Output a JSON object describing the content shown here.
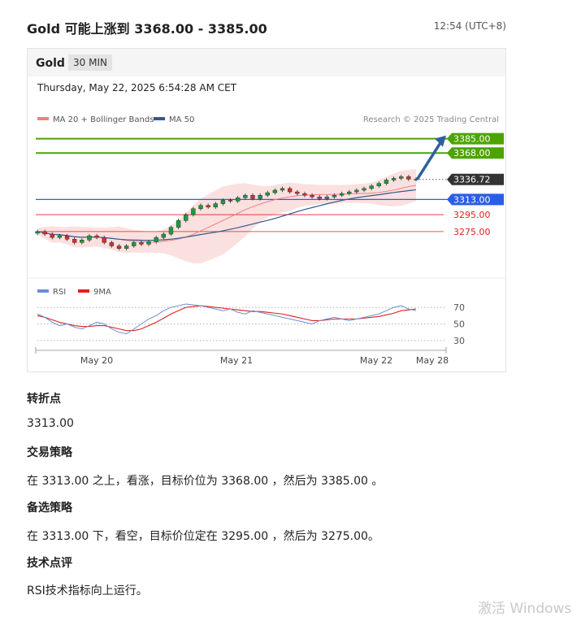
{
  "header": {
    "title": "Gold 可能上涨到 3368.00 - 3385.00",
    "time": "12:54 (UTC+8)"
  },
  "panel": {
    "symbol": "Gold",
    "timeframe": "30 MIN",
    "date": "Thursday, May 22, 2025 6:54:28 AM CET"
  },
  "chart_data": {
    "type": "candlestick",
    "legend_top": [
      {
        "name": "MA 20 + Bollinger Bands",
        "color": "#f07f7f"
      },
      {
        "name": "MA 50",
        "color": "#2f5a8c"
      }
    ],
    "credit": "Research © 2025 Trading Central",
    "ylim": [
      3220,
      3400
    ],
    "close": [
      3275,
      3272,
      3268,
      3270,
      3266,
      3262,
      3265,
      3270,
      3268,
      3262,
      3258,
      3255,
      3258,
      3262,
      3260,
      3263,
      3268,
      3272,
      3280,
      3288,
      3295,
      3302,
      3306,
      3304,
      3308,
      3312,
      3311,
      3315,
      3318,
      3314,
      3318,
      3321,
      3324,
      3326,
      3322,
      3320,
      3318,
      3316,
      3314,
      3316,
      3318,
      3320,
      3322,
      3324,
      3326,
      3329,
      3332,
      3336,
      3338,
      3340,
      3337,
      3336.72
    ],
    "levels": {
      "resistance": [
        3385.0,
        3368.0
      ],
      "pivot": 3313.0,
      "support": [
        3295.0,
        3275.0
      ],
      "last": 3336.72
    },
    "level_labels": [
      "3385.00",
      "3368.00",
      "3336.72",
      "3313.00",
      "3295.00",
      "3275.00"
    ],
    "rsi": {
      "legend": [
        {
          "name": "RSI",
          "color": "#6d8ed6"
        },
        {
          "name": "9MA",
          "color": "#e02020"
        }
      ],
      "ticks": [
        70,
        50,
        30
      ],
      "values": [
        62,
        58,
        52,
        48,
        50,
        46,
        44,
        48,
        52,
        50,
        44,
        40,
        38,
        44,
        50,
        56,
        60,
        66,
        70,
        72,
        74,
        73,
        72,
        70,
        68,
        66,
        68,
        64,
        62,
        66,
        64,
        62,
        60,
        58,
        56,
        54,
        52,
        50,
        54,
        56,
        58,
        56,
        54,
        56,
        58,
        60,
        62,
        66,
        70,
        72,
        68,
        66
      ],
      "ma": [
        60,
        58,
        55,
        52,
        50,
        48,
        47,
        47,
        48,
        48,
        46,
        44,
        42,
        42,
        44,
        48,
        52,
        57,
        62,
        66,
        70,
        71,
        72,
        71,
        70,
        69,
        68,
        67,
        66,
        65,
        65,
        64,
        63,
        62,
        60,
        58,
        56,
        54,
        54,
        55,
        56,
        56,
        56,
        56,
        57,
        58,
        59,
        61,
        63,
        66,
        67,
        68
      ]
    },
    "x_ticks": [
      "May 20",
      "May 21",
      "May 22",
      "May 28"
    ],
    "colors": {
      "resistance": "#4ca400",
      "pivot": "#2a5ee8",
      "support": "#e02020",
      "last": "#333333",
      "arrow": "#2f5f9e"
    }
  },
  "sections": [
    {
      "heading": "转折点",
      "text": "3313.00"
    },
    {
      "heading": "交易策略",
      "text": "在 3313.00 之上，看涨，目标价位为 3368.00 ，然后为 3385.00 。"
    },
    {
      "heading": "备选策略",
      "text": "在 3313.00 下，看空，目标价位定在 3295.00 ，然后为 3275.00。"
    },
    {
      "heading": "技术点评",
      "text": "RSI技术指标向上运行。"
    }
  ],
  "watermark": "激活 Windows"
}
